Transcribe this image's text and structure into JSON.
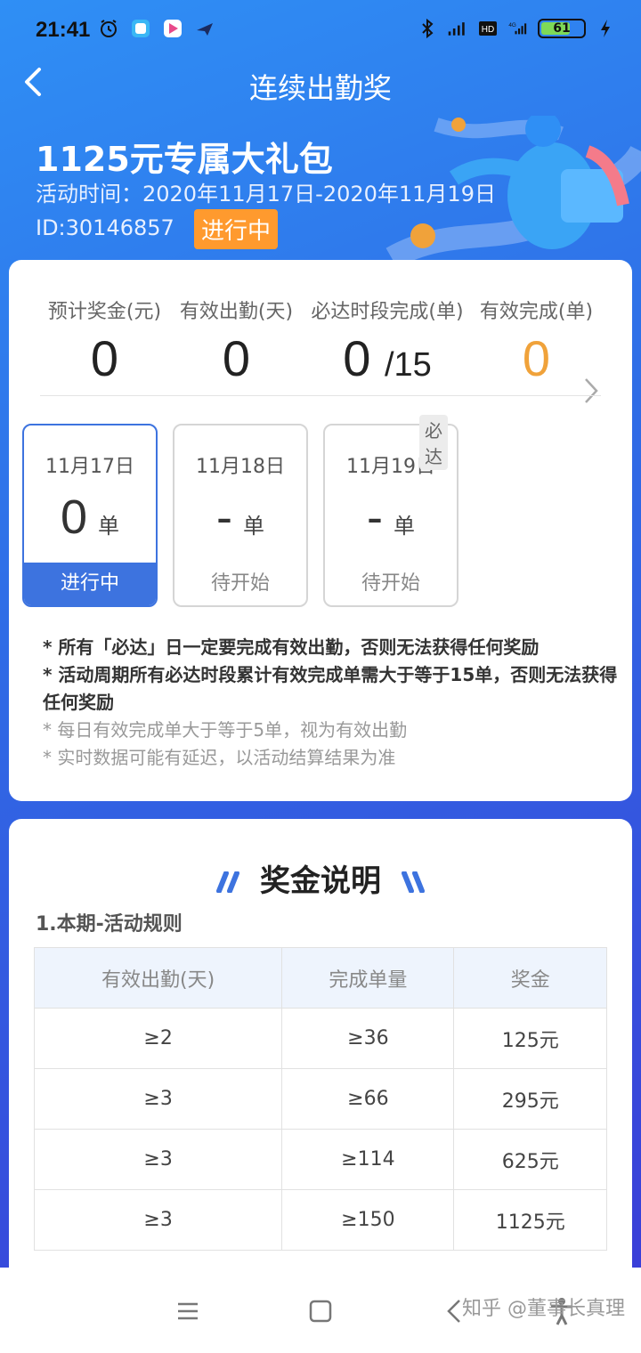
{
  "status_bar": {
    "time": "21:41",
    "battery_percent": "61"
  },
  "nav": {
    "title": "连续出勤奖"
  },
  "hero": {
    "title": "1125元专属大礼包",
    "time": "活动时间：2020年11月17日-2020年11月19日",
    "id": "ID:30146857",
    "status": "进行中"
  },
  "stats": [
    {
      "label": "预计奖金(元)",
      "value": "0"
    },
    {
      "label": "有效出勤(天)",
      "value": "0"
    },
    {
      "label": "必达时段完成(单)",
      "value": "0",
      "sub": "/15"
    },
    {
      "label": "有效完成(单)",
      "value": "0"
    }
  ],
  "days": [
    {
      "date": "11月17日",
      "count": "0",
      "unit": "单",
      "status": "进行中"
    },
    {
      "date": "11月18日",
      "count": "-",
      "unit": "单",
      "status": "待开始"
    },
    {
      "date": "11月19日",
      "count": "-",
      "unit": "单",
      "status": "待开始",
      "tag": "必达"
    }
  ],
  "notes": [
    "* 所有「必达」日一定要完成有效出勤，否则无法获得任何奖励",
    "* 活动周期所有必达时段累计有效完成单需大于等于15单，否则无法获得任何奖励",
    "* 每日有效完成单大于等于5单，视为有效出勤",
    "* 实时数据可能有延迟，以活动结算结果为准"
  ],
  "bonus": {
    "title": "奖金说明",
    "rule_title": "1.本期-活动规则",
    "headers": [
      "有效出勤(天)",
      "完成单量",
      "奖金"
    ],
    "rows": [
      [
        "≥2",
        "≥36",
        "125元"
      ],
      [
        "≥3",
        "≥66",
        "295元"
      ],
      [
        "≥3",
        "≥114",
        "625元"
      ],
      [
        "≥3",
        "≥150",
        "1125元"
      ]
    ]
  },
  "watermark": "知乎 @董事长真理",
  "colors": {
    "accent_blue": "#3d73df",
    "badge_orange": "#ff9a2e",
    "value_orange": "#f0a23a"
  }
}
